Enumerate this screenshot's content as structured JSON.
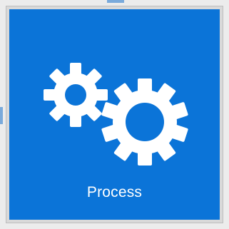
{
  "tile": {
    "label": "Process",
    "icon": "gears-icon",
    "background_color": "#0b74d8",
    "icon_color": "#ffffff"
  }
}
